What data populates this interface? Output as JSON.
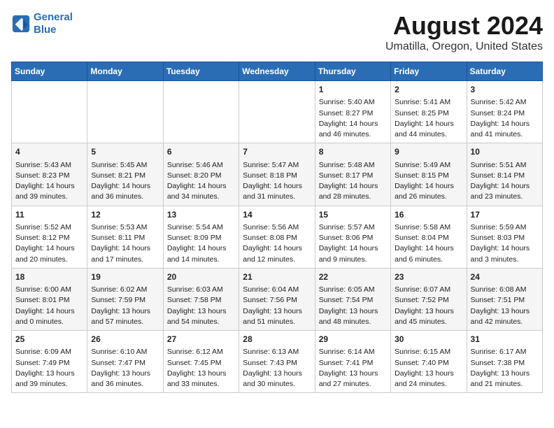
{
  "logo": {
    "line1": "General",
    "line2": "Blue"
  },
  "title": "August 2024",
  "subtitle": "Umatilla, Oregon, United States",
  "days_of_week": [
    "Sunday",
    "Monday",
    "Tuesday",
    "Wednesday",
    "Thursday",
    "Friday",
    "Saturday"
  ],
  "weeks": [
    [
      {
        "day": "",
        "content": ""
      },
      {
        "day": "",
        "content": ""
      },
      {
        "day": "",
        "content": ""
      },
      {
        "day": "",
        "content": ""
      },
      {
        "day": "1",
        "content": "Sunrise: 5:40 AM\nSunset: 8:27 PM\nDaylight: 14 hours\nand 46 minutes."
      },
      {
        "day": "2",
        "content": "Sunrise: 5:41 AM\nSunset: 8:25 PM\nDaylight: 14 hours\nand 44 minutes."
      },
      {
        "day": "3",
        "content": "Sunrise: 5:42 AM\nSunset: 8:24 PM\nDaylight: 14 hours\nand 41 minutes."
      }
    ],
    [
      {
        "day": "4",
        "content": "Sunrise: 5:43 AM\nSunset: 8:23 PM\nDaylight: 14 hours\nand 39 minutes."
      },
      {
        "day": "5",
        "content": "Sunrise: 5:45 AM\nSunset: 8:21 PM\nDaylight: 14 hours\nand 36 minutes."
      },
      {
        "day": "6",
        "content": "Sunrise: 5:46 AM\nSunset: 8:20 PM\nDaylight: 14 hours\nand 34 minutes."
      },
      {
        "day": "7",
        "content": "Sunrise: 5:47 AM\nSunset: 8:18 PM\nDaylight: 14 hours\nand 31 minutes."
      },
      {
        "day": "8",
        "content": "Sunrise: 5:48 AM\nSunset: 8:17 PM\nDaylight: 14 hours\nand 28 minutes."
      },
      {
        "day": "9",
        "content": "Sunrise: 5:49 AM\nSunset: 8:15 PM\nDaylight: 14 hours\nand 26 minutes."
      },
      {
        "day": "10",
        "content": "Sunrise: 5:51 AM\nSunset: 8:14 PM\nDaylight: 14 hours\nand 23 minutes."
      }
    ],
    [
      {
        "day": "11",
        "content": "Sunrise: 5:52 AM\nSunset: 8:12 PM\nDaylight: 14 hours\nand 20 minutes."
      },
      {
        "day": "12",
        "content": "Sunrise: 5:53 AM\nSunset: 8:11 PM\nDaylight: 14 hours\nand 17 minutes."
      },
      {
        "day": "13",
        "content": "Sunrise: 5:54 AM\nSunset: 8:09 PM\nDaylight: 14 hours\nand 14 minutes."
      },
      {
        "day": "14",
        "content": "Sunrise: 5:56 AM\nSunset: 8:08 PM\nDaylight: 14 hours\nand 12 minutes."
      },
      {
        "day": "15",
        "content": "Sunrise: 5:57 AM\nSunset: 8:06 PM\nDaylight: 14 hours\nand 9 minutes."
      },
      {
        "day": "16",
        "content": "Sunrise: 5:58 AM\nSunset: 8:04 PM\nDaylight: 14 hours\nand 6 minutes."
      },
      {
        "day": "17",
        "content": "Sunrise: 5:59 AM\nSunset: 8:03 PM\nDaylight: 14 hours\nand 3 minutes."
      }
    ],
    [
      {
        "day": "18",
        "content": "Sunrise: 6:00 AM\nSunset: 8:01 PM\nDaylight: 14 hours\nand 0 minutes."
      },
      {
        "day": "19",
        "content": "Sunrise: 6:02 AM\nSunset: 7:59 PM\nDaylight: 13 hours\nand 57 minutes."
      },
      {
        "day": "20",
        "content": "Sunrise: 6:03 AM\nSunset: 7:58 PM\nDaylight: 13 hours\nand 54 minutes."
      },
      {
        "day": "21",
        "content": "Sunrise: 6:04 AM\nSunset: 7:56 PM\nDaylight: 13 hours\nand 51 minutes."
      },
      {
        "day": "22",
        "content": "Sunrise: 6:05 AM\nSunset: 7:54 PM\nDaylight: 13 hours\nand 48 minutes."
      },
      {
        "day": "23",
        "content": "Sunrise: 6:07 AM\nSunset: 7:52 PM\nDaylight: 13 hours\nand 45 minutes."
      },
      {
        "day": "24",
        "content": "Sunrise: 6:08 AM\nSunset: 7:51 PM\nDaylight: 13 hours\nand 42 minutes."
      }
    ],
    [
      {
        "day": "25",
        "content": "Sunrise: 6:09 AM\nSunset: 7:49 PM\nDaylight: 13 hours\nand 39 minutes."
      },
      {
        "day": "26",
        "content": "Sunrise: 6:10 AM\nSunset: 7:47 PM\nDaylight: 13 hours\nand 36 minutes."
      },
      {
        "day": "27",
        "content": "Sunrise: 6:12 AM\nSunset: 7:45 PM\nDaylight: 13 hours\nand 33 minutes."
      },
      {
        "day": "28",
        "content": "Sunrise: 6:13 AM\nSunset: 7:43 PM\nDaylight: 13 hours\nand 30 minutes."
      },
      {
        "day": "29",
        "content": "Sunrise: 6:14 AM\nSunset: 7:41 PM\nDaylight: 13 hours\nand 27 minutes."
      },
      {
        "day": "30",
        "content": "Sunrise: 6:15 AM\nSunset: 7:40 PM\nDaylight: 13 hours\nand 24 minutes."
      },
      {
        "day": "31",
        "content": "Sunrise: 6:17 AM\nSunset: 7:38 PM\nDaylight: 13 hours\nand 21 minutes."
      }
    ]
  ]
}
